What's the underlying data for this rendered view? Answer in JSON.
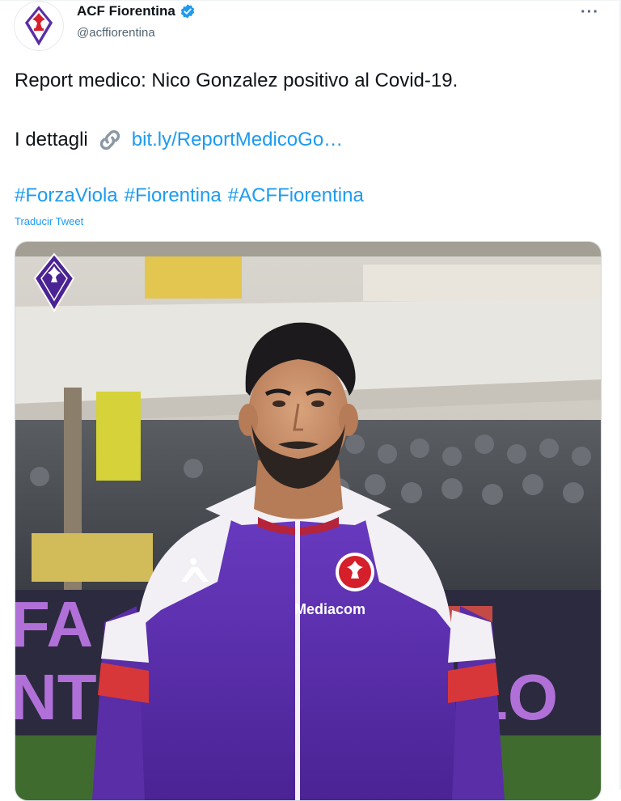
{
  "account": {
    "name": "ACF Fiorentina",
    "handle": "@acffiorentina",
    "avatar_icon": "fiorentina-crest-icon",
    "verified_icon": "verified-badge-icon"
  },
  "more_icon": "more-options-icon",
  "more_label": "···",
  "tweet": {
    "line1": "Report medico: Nico Gonzalez positivo al Covid-19.",
    "details_label": "I dettagli",
    "link_icon": "link-icon",
    "link_text": "bit.ly/ReportMedicoGo…",
    "hashtags": [
      "#ForzaViola",
      "#Fiorentina",
      "#ACFFiorentina"
    ],
    "translate_label": "Traducir Tweet"
  },
  "photo": {
    "alt": "Nico Gonzalez in purple Fiorentina jacket",
    "jersey_brand": "Mediacom",
    "banner_letters": [
      "FA",
      "NT",
      "LO"
    ]
  },
  "colors": {
    "link": "#1d9bf0",
    "fiorentina_purple": "#5a2ea6"
  }
}
